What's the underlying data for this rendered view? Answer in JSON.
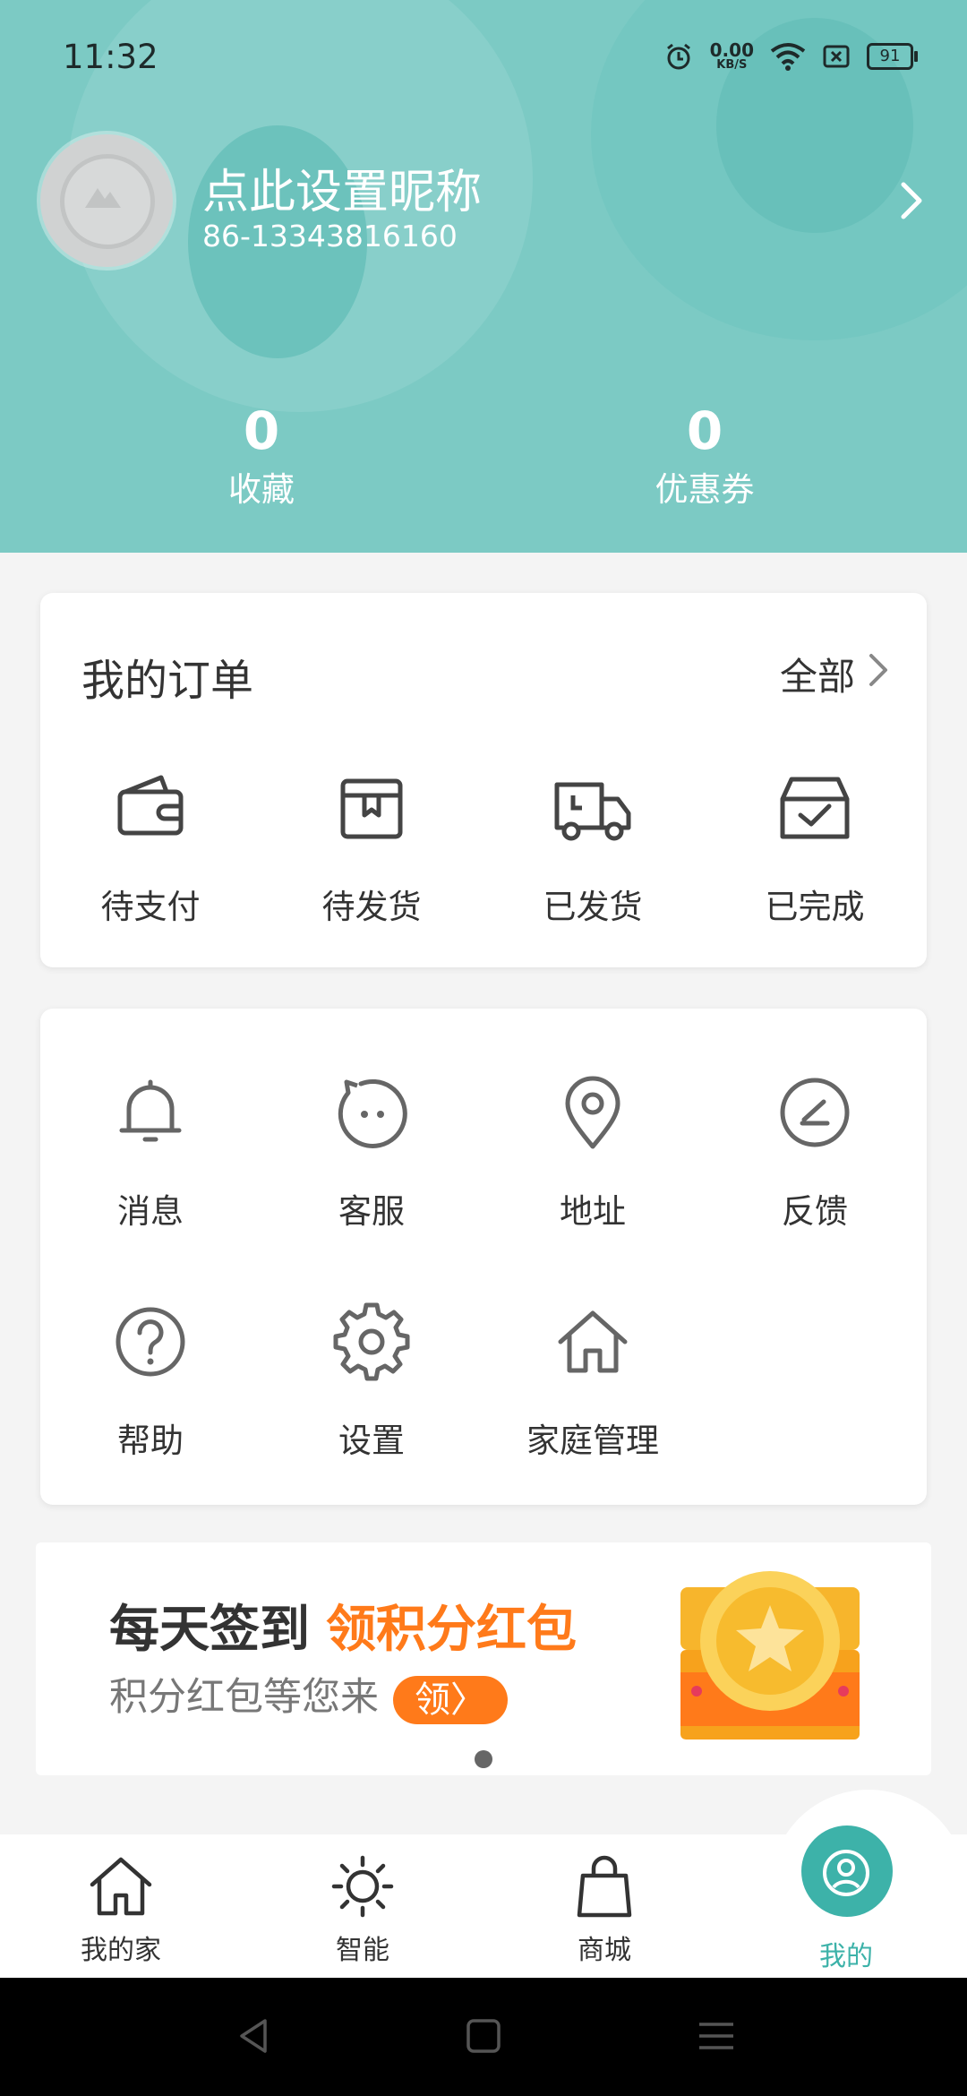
{
  "status_bar": {
    "time": "11:32",
    "net_speed": "0.00",
    "net_unit": "KB/S",
    "battery": "91"
  },
  "profile": {
    "nickname": "点此设置昵称",
    "phone": "86-13343816160"
  },
  "stats": [
    {
      "value": "0",
      "label": "收藏"
    },
    {
      "value": "0",
      "label": "优惠券"
    }
  ],
  "orders": {
    "title": "我的订单",
    "all_label": "全部",
    "items": [
      {
        "label": "待支付",
        "icon": "wallet-icon"
      },
      {
        "label": "待发货",
        "icon": "package-icon"
      },
      {
        "label": "已发货",
        "icon": "truck-icon"
      },
      {
        "label": "已完成",
        "icon": "completed-box-icon"
      }
    ]
  },
  "services": {
    "items": [
      {
        "label": "消息",
        "icon": "bell-icon"
      },
      {
        "label": "客服",
        "icon": "customer-service-icon"
      },
      {
        "label": "地址",
        "icon": "location-pin-icon"
      },
      {
        "label": "反馈",
        "icon": "feedback-icon"
      },
      {
        "label": "帮助",
        "icon": "help-icon"
      },
      {
        "label": "设置",
        "icon": "gear-icon"
      },
      {
        "label": "家庭管理",
        "icon": "home-icon"
      }
    ]
  },
  "banner": {
    "line1_prefix": "每天签到",
    "line1_highlight": "领积分红包",
    "line2": "积分红包等您来",
    "button": "领",
    "button_arrow": "〉",
    "page_count": 1
  },
  "tabs": [
    {
      "label": "我的家",
      "icon": "house-icon",
      "active": false
    },
    {
      "label": "智能",
      "icon": "sun-icon",
      "active": false
    },
    {
      "label": "商城",
      "icon": "shopping-bag-icon",
      "active": false
    },
    {
      "label": "我的",
      "icon": "user-profile-icon",
      "active": true
    }
  ],
  "colors": {
    "header_bg": "#7ccac4",
    "accent": "#3db2a9",
    "highlight_orange": "#ff7a1a"
  }
}
